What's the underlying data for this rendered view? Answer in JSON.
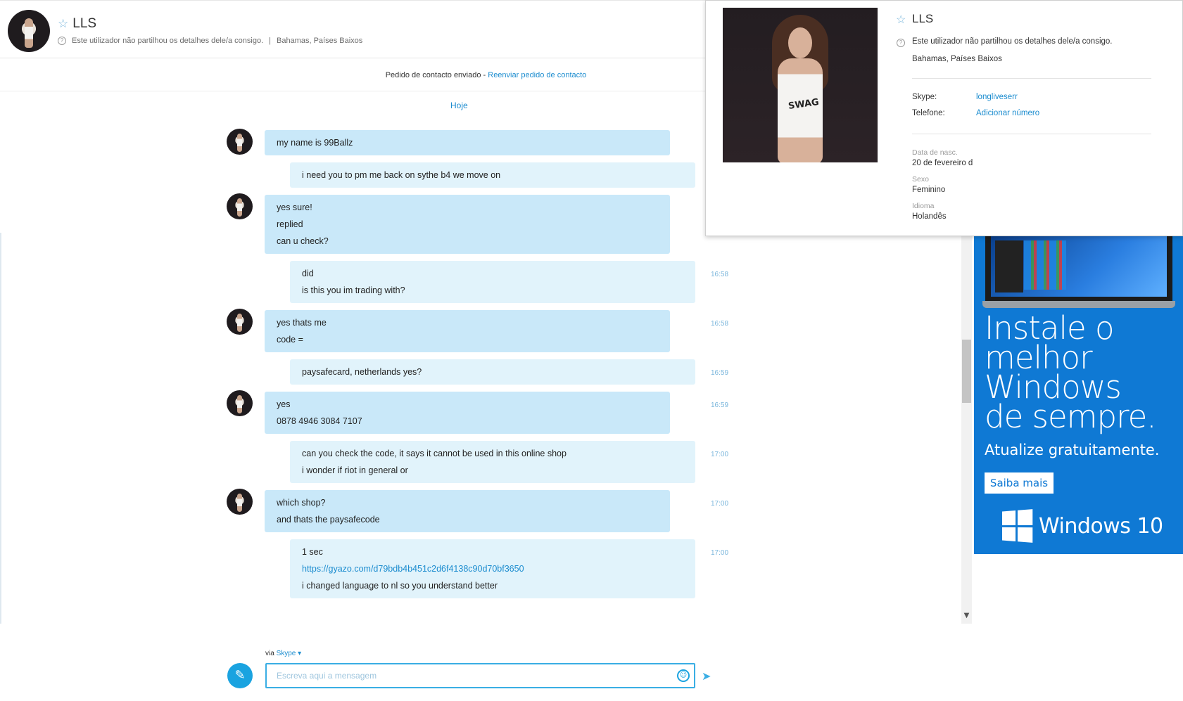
{
  "contact": {
    "name": "LLS",
    "status": "Este utilizador não partilhou os detalhes dele/a consigo.",
    "location": "Bahamas, Países Baixos",
    "separator": "|"
  },
  "notice": {
    "text": "Pedido de contacto enviado - ",
    "link": "Reenviar pedido de contacto"
  },
  "chat": {
    "day_label": "Hoje",
    "messages": [
      {
        "dir": "in",
        "lines": [
          "my name is 99Ballz"
        ],
        "time": ""
      },
      {
        "dir": "out",
        "lines": [
          "i need you to pm me back on sythe b4 we move on"
        ],
        "time": ""
      },
      {
        "dir": "in",
        "lines": [
          "yes sure!",
          "replied",
          "can u check?"
        ],
        "time": ""
      },
      {
        "dir": "out",
        "lines": [
          "did",
          "is this you im trading with?"
        ],
        "time": "16:58"
      },
      {
        "dir": "in",
        "lines": [
          "yes thats me",
          "code ="
        ],
        "time": "16:58"
      },
      {
        "dir": "out",
        "lines": [
          "paysafecard, netherlands yes?"
        ],
        "time": "16:59"
      },
      {
        "dir": "in",
        "lines": [
          "yes",
          "0878 4946 3084 7107"
        ],
        "time": "16:59"
      },
      {
        "dir": "out",
        "lines": [
          "can you check the code, it says it cannot be used in this online shop",
          "i wonder if riot in general or"
        ],
        "time": "17:00"
      },
      {
        "dir": "in",
        "lines": [
          "which shop?",
          "and thats the paysafecode"
        ],
        "time": "17:00"
      },
      {
        "dir": "out",
        "lines": [
          "1 sec",
          "https://gyazo.com/d79bdb4b451c2d6f4138c90d70bf3650",
          "i changed language to nl so you understand better"
        ],
        "time": "17:00",
        "link_line": 1
      }
    ]
  },
  "composer": {
    "via_label": "via",
    "via_service": "Skype",
    "placeholder": "Escreva aqui a mensagem"
  },
  "profile": {
    "name": "LLS",
    "status": "Este utilizador não partilhou os detalhes dele/a consigo.",
    "location": "Bahamas, Países Baixos",
    "skype_label": "Skype:",
    "skype_value": "longliveserr",
    "phone_label": "Telefone:",
    "phone_value": "Adicionar número",
    "birth_label": "Data de nasc.",
    "birth_value": "20 de fevereiro d",
    "gender_label": "Sexo",
    "gender_value": "Feminino",
    "language_label": "Idioma",
    "language_value": "Holandês",
    "photo_text": "SWAG"
  },
  "ad": {
    "headline": [
      "Instale o",
      "melhor",
      "Windows",
      "de sempre."
    ],
    "subline": "Atualize gratuitamente.",
    "button": "Saiba mais",
    "logo_text": "Windows 10",
    "color": "#0f79d4"
  },
  "colors": {
    "accent": "#1b8ccf",
    "bubble_in": "#c9e8f9",
    "bubble_out": "#e1f3fb"
  }
}
